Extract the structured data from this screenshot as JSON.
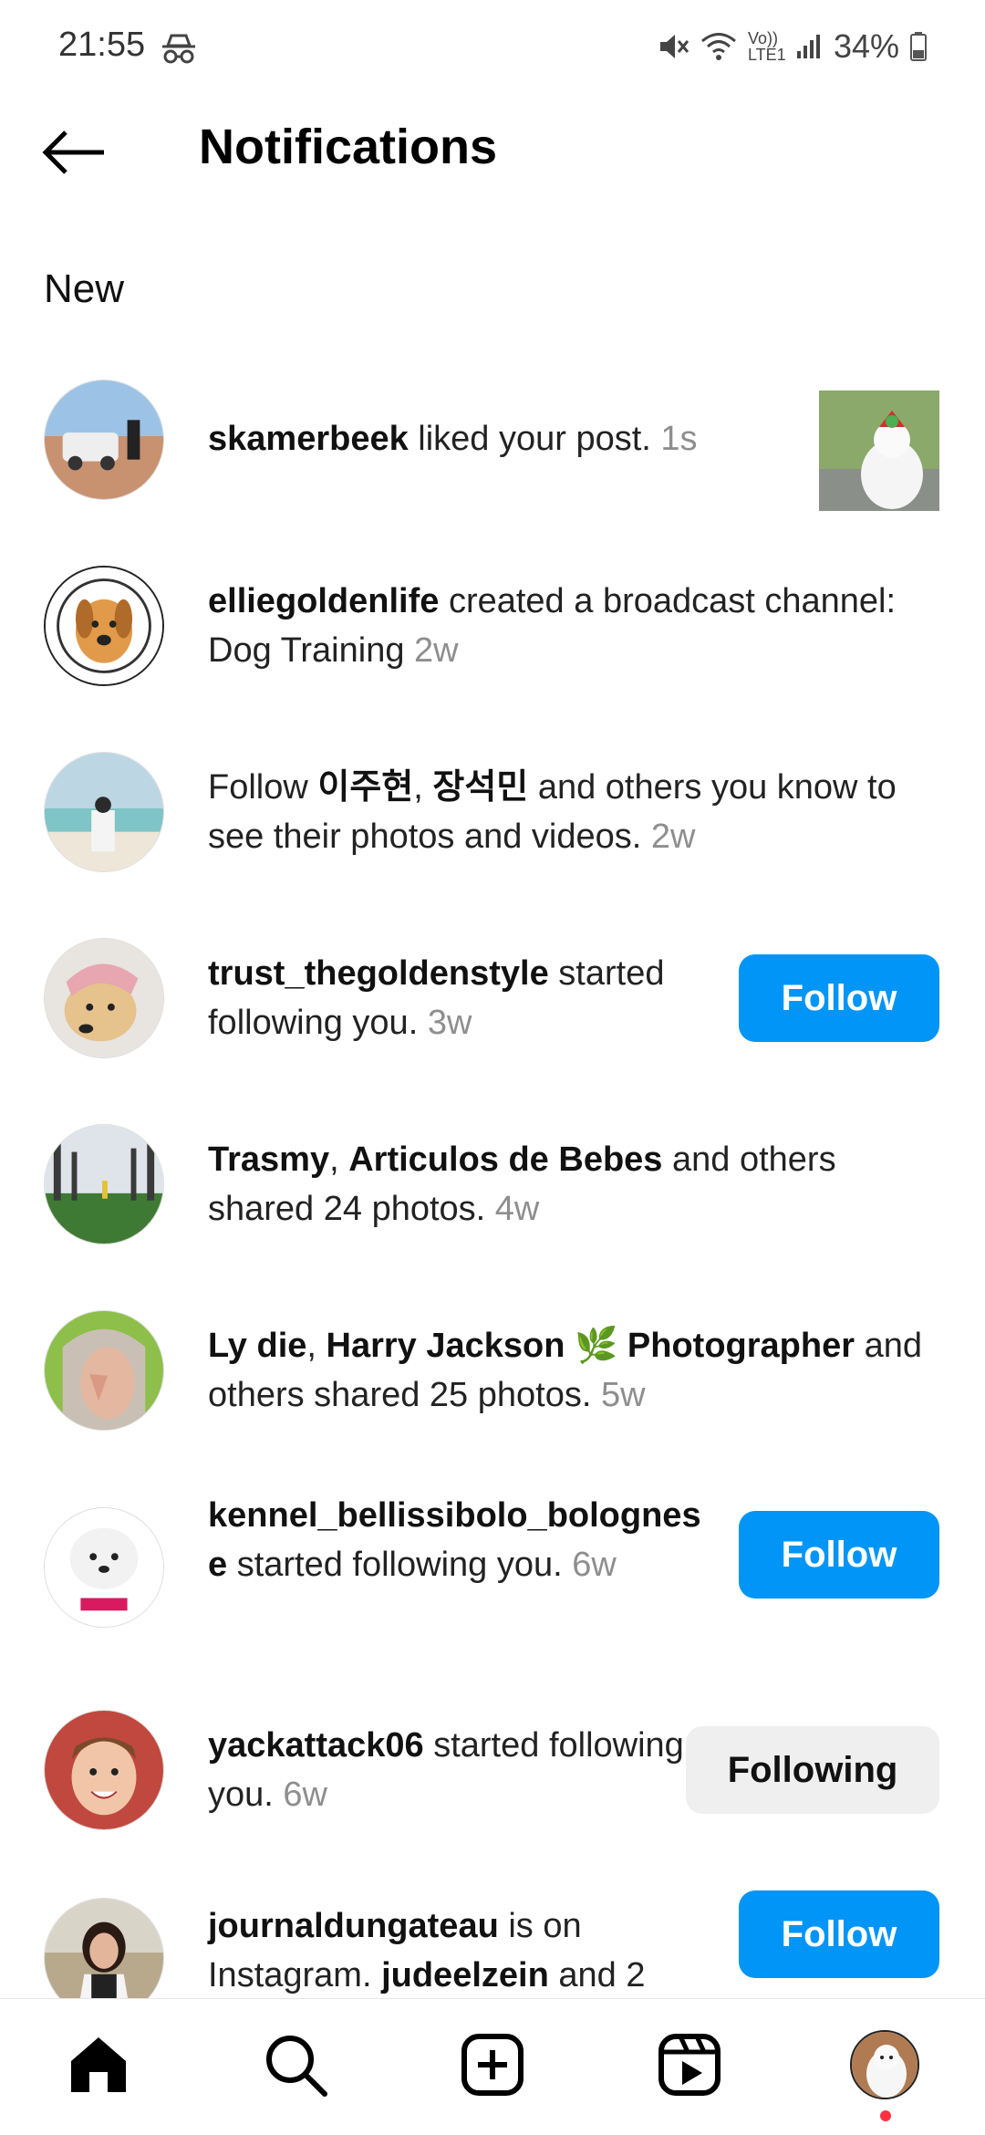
{
  "status_bar": {
    "time": "21:55",
    "battery": "34%",
    "network_label": "Vo)) LTE1"
  },
  "header": {
    "title": "Notifications"
  },
  "section_new": "New",
  "notifications": [
    {
      "user": "skamerbeek",
      "text": " liked your post. ",
      "time": "1s"
    },
    {
      "user": "elliegoldenlife",
      "text": " created a broadcast channel: Dog Training ",
      "time": "2w"
    },
    {
      "pre": "Follow ",
      "user": "이주현",
      "sep": ", ",
      "user2": "장석민",
      "text": " and others you know to see their photos and videos. ",
      "time": "2w"
    },
    {
      "user": "trust_thegoldenstyle",
      "text": " started following you. ",
      "time": "3w",
      "button": "Follow"
    },
    {
      "user": "Trasmy",
      "sep": ", ",
      "user2": "Articulos de Bebes",
      "text": " and others shared 24 photos. ",
      "time": "4w"
    },
    {
      "user": "Ly die",
      "sep": ", ",
      "user2": "Harry Jackson 🌿 Photographer",
      "text": " and others shared 25 photos. ",
      "time": "5w"
    },
    {
      "user": "kennel_bellissibolo_bolognese",
      "text": " started following you. ",
      "time": "6w",
      "button": "Follow"
    },
    {
      "user": "yackattack06",
      "text": " started following you. ",
      "time": "6w",
      "button": "Following"
    },
    {
      "user": "journaldungateau",
      "text": " is on Instagram. ",
      "user2": "judeelzein",
      "text2": " and 2",
      "button": "Follow"
    }
  ],
  "bottom_nav": {
    "items": [
      "home-icon",
      "search-icon",
      "create-icon",
      "reels-icon",
      "profile-avatar"
    ]
  },
  "colors": {
    "follow_blue": "#0095f6",
    "following_gray": "#efefef",
    "notification_dot": "#ff3040"
  }
}
